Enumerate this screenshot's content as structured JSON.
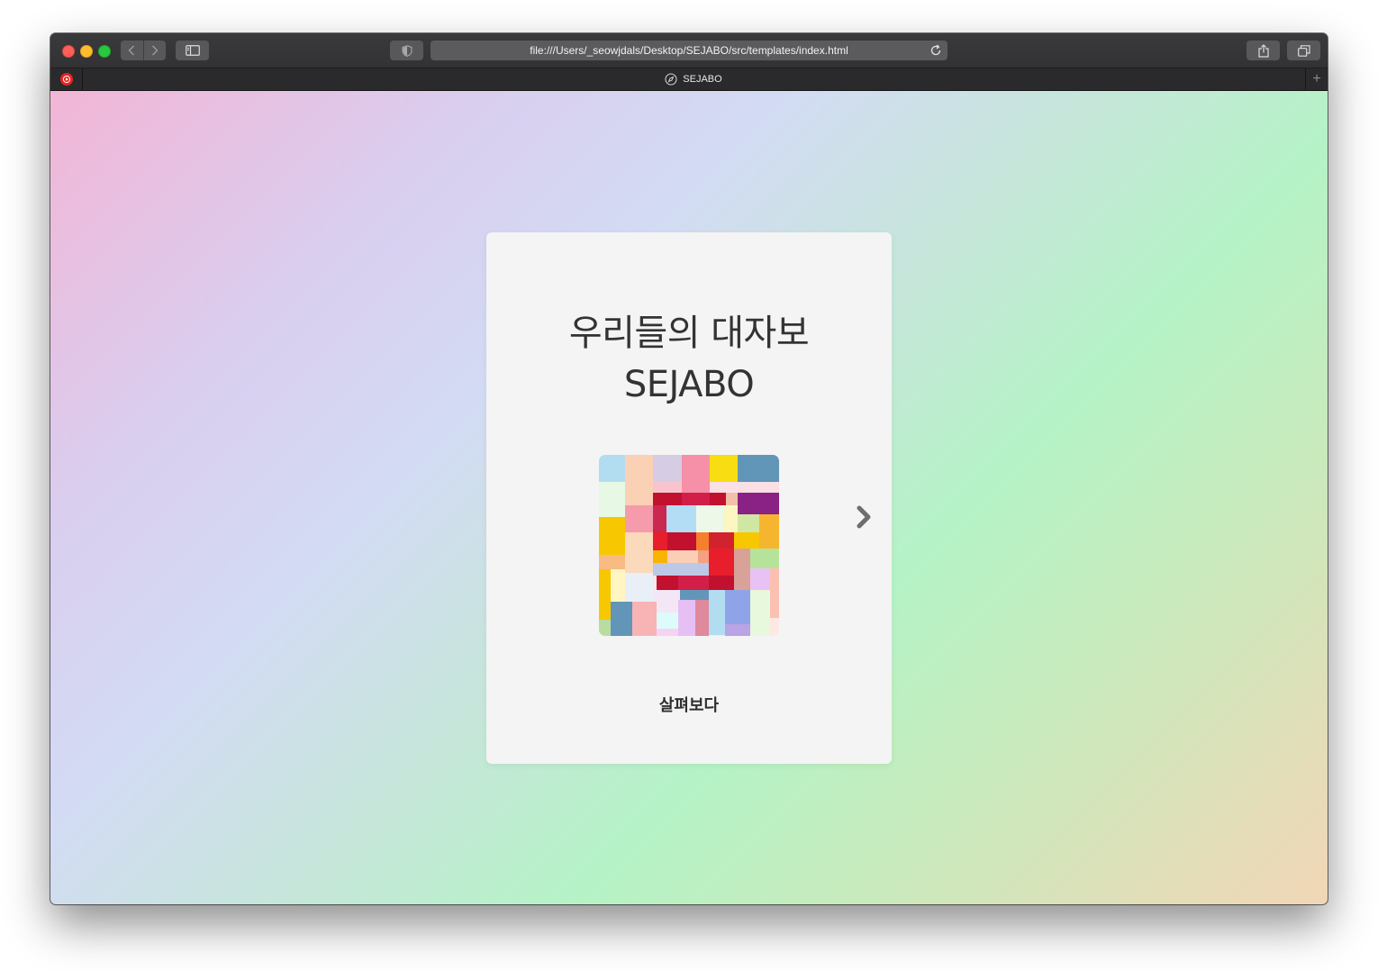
{
  "browser": {
    "url": "file:///Users/_seowjdals/Desktop/SEJABO/src/templates/index.html",
    "tab_title": "SEJABO",
    "new_tab_label": "+"
  },
  "card": {
    "title_line1": "우리들의 대자보",
    "title_line2": "SEJABO",
    "browse_label": "살펴보다"
  },
  "icons": {
    "back": "chevron-left-icon",
    "forward": "chevron-right-icon",
    "sidebar": "sidebar-icon",
    "privacy": "shield-icon",
    "reload": "reload-icon",
    "share": "share-icon",
    "tabs": "tabs-overview-icon",
    "pinned_tab": "youtube-music-icon",
    "tab_favicon": "compass-icon",
    "next": "chevron-right-icon"
  },
  "colors": {
    "background_gradient": [
      "#f3b5d6",
      "#d3dbf4",
      "#b5f3c6",
      "#f2d6b6"
    ],
    "card_bg": "#f4f4f4",
    "title_text": "#333333",
    "arrow": "#6e6e6e"
  }
}
